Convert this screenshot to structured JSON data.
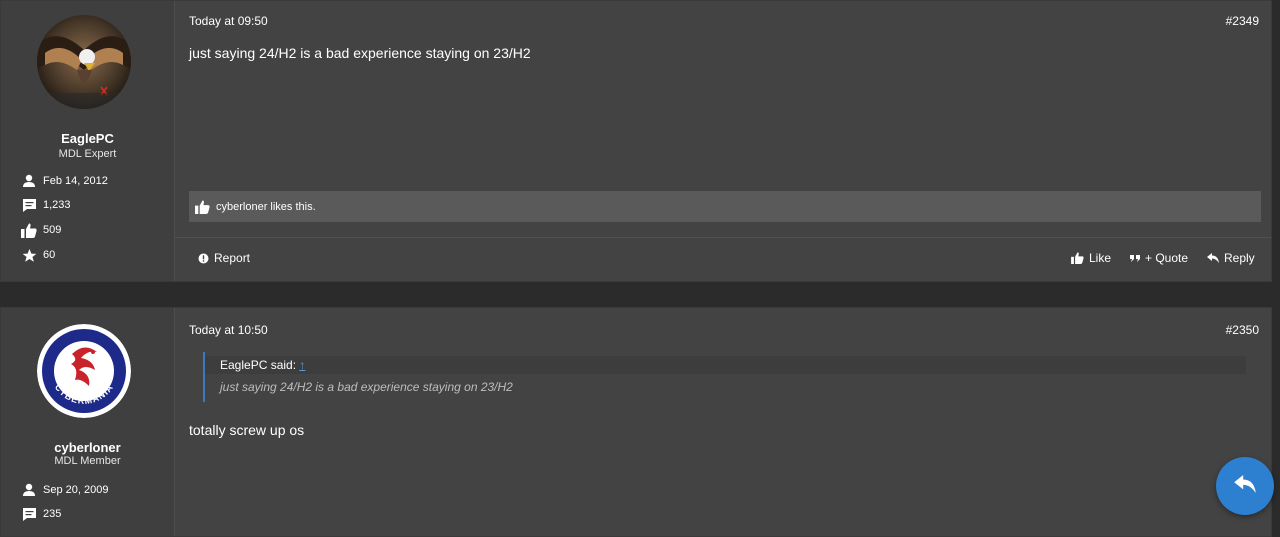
{
  "posts": [
    {
      "username": "EaglePC",
      "user_title": "MDL Expert",
      "stats": {
        "joined": "Feb 14, 2012",
        "messages": "1,233",
        "likes": "509",
        "points": "60"
      },
      "timestamp": "Today at 09:50",
      "post_number": "#2349",
      "message": "just saying 24/H2 is a bad experience staying on 23/H2",
      "likes_summary": "cyberloner likes this.",
      "actions": {
        "report": "Report",
        "like": "Like",
        "quote": "+ Quote",
        "reply": "Reply"
      }
    },
    {
      "username": "cyberloner",
      "user_title": "MDL Member",
      "avatar_text": "CYBERMANIA",
      "stats": {
        "joined": "Sep 20, 2009",
        "messages": "235"
      },
      "timestamp": "Today at 10:50",
      "post_number": "#2350",
      "quote": {
        "author": "EaglePC said:",
        "arrow": "↑",
        "text": "just saying 24/H2 is a bad experience staying on 23/H2"
      },
      "message": "totally screw up os"
    }
  ],
  "colors": {
    "background": "#2b2b2b",
    "post_bg": "#434343",
    "accent": "#2d7fd0",
    "quote_border": "#3a7bbf"
  },
  "icons": {
    "joined": "user-icon",
    "messages": "comment-icon",
    "likes": "thumbs-up-icon",
    "points": "star-icon",
    "report": "info-circle-icon",
    "quote": "quote-icon",
    "reply": "reply-icon",
    "fab": "reply-icon"
  }
}
